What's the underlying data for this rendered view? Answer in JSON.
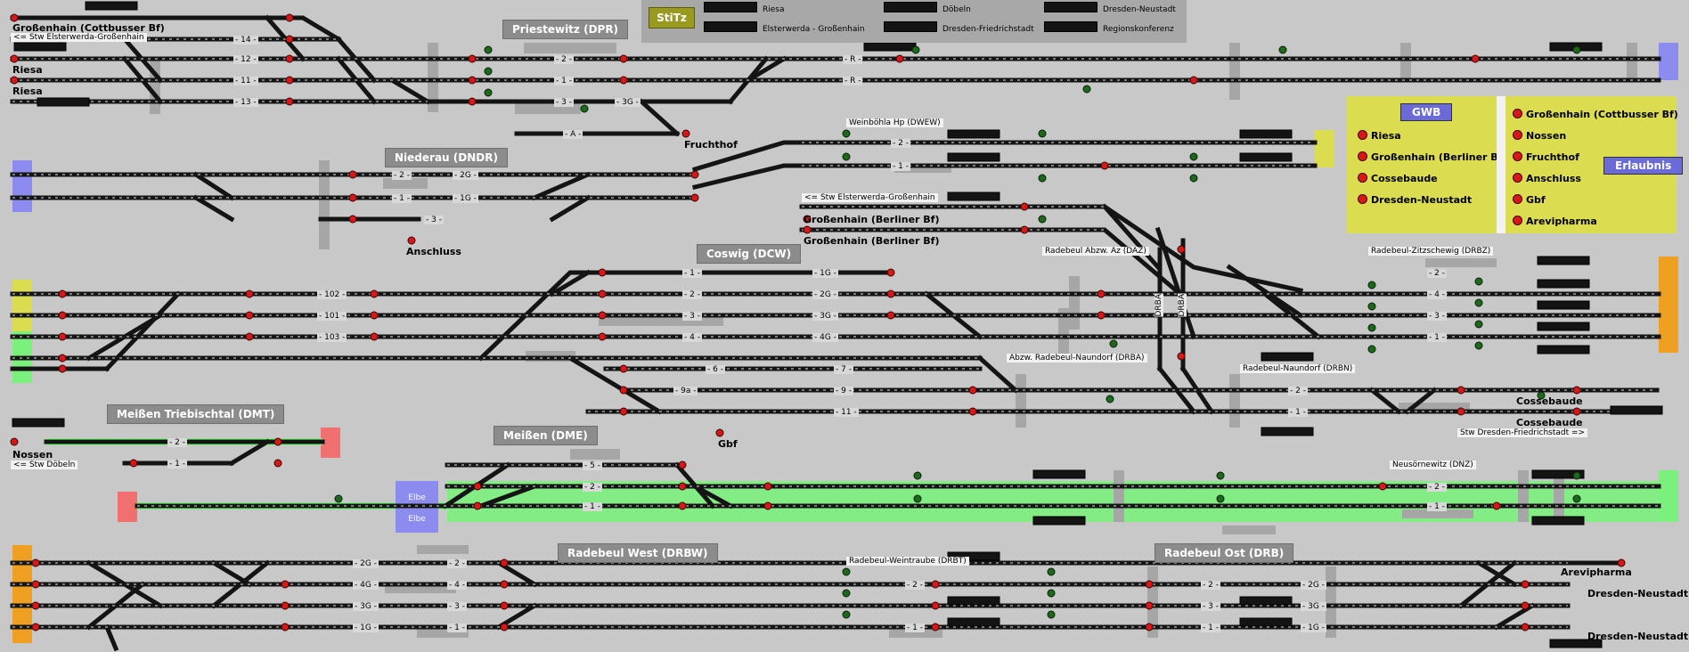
{
  "legend": {
    "stitz_label": "StiTz",
    "items": [
      "Riesa",
      "Elsterwerda - Großenhain",
      "Döbeln",
      "Dresden-Friedrichstadt",
      "Dresden-Neustadt",
      "Regionskonferenz"
    ]
  },
  "stations": [
    {
      "id": "dpr",
      "label": "Priestewitz (DPR)"
    },
    {
      "id": "dndr",
      "label": "Niederau (DNDR)"
    },
    {
      "id": "dcw",
      "label": "Coswig (DCW)"
    },
    {
      "id": "dmt",
      "label": "Meißen Triebischtal (DMT)"
    },
    {
      "id": "dme",
      "label": "Meißen (DME)"
    },
    {
      "id": "drbw",
      "label": "Radebeul West (DRBW)"
    },
    {
      "id": "drb",
      "label": "Radebeul Ost (DRB)"
    }
  ],
  "places": [
    {
      "id": "grossenhain-cott",
      "label": "Großenhain (Cottbusser Bf)"
    },
    {
      "id": "riesa1",
      "label": "Riesa"
    },
    {
      "id": "riesa2",
      "label": "Riesa"
    },
    {
      "id": "fruchthof",
      "label": "Fruchthof"
    },
    {
      "id": "anschluss",
      "label": "Anschluss"
    },
    {
      "id": "grossenhain-berl1",
      "label": "Großenhain (Berliner Bf)"
    },
    {
      "id": "grossenhain-berl2",
      "label": "Großenhain (Berliner Bf)"
    },
    {
      "id": "nossen",
      "label": "Nossen"
    },
    {
      "id": "gbf",
      "label": "Gbf"
    },
    {
      "id": "cossebaude1",
      "label": "Cossebaude"
    },
    {
      "id": "cossebaude2",
      "label": "Cossebaude"
    },
    {
      "id": "arevipharma",
      "label": "Arevipharma"
    },
    {
      "id": "dn1",
      "label": "Dresden-Neustadt"
    },
    {
      "id": "dn2",
      "label": "Dresden-Neustadt"
    }
  ],
  "notes": [
    {
      "id": "stw-elster1",
      "label": "<= Stw Elsterwerda-Großenhain"
    },
    {
      "id": "dwew",
      "label": "Weinböhla Hp (DWEW)"
    },
    {
      "id": "stw-elster2",
      "label": "<= Stw Elsterwerda-Großenhain"
    },
    {
      "id": "daz",
      "label": "Radebeul Abzw. Az (DAZ)"
    },
    {
      "id": "drbz",
      "label": "Radebeul-Zitzschewig (DRBZ)"
    },
    {
      "id": "drba",
      "label": "Abzw. Radebeul-Naundorf (DRBA)"
    },
    {
      "id": "drbn",
      "label": "Radebeul-Naundorf (DRBN)"
    },
    {
      "id": "stw-dresden",
      "label": "Stw Dresden-Friedrichstadt =>"
    },
    {
      "id": "stw-doebeln",
      "label": "<= Stw Döbeln"
    },
    {
      "id": "dnz",
      "label": "Neusörnewitz (DNZ)"
    },
    {
      "id": "drbt",
      "label": "Radebeul-Weintraube (DRBT)"
    }
  ],
  "elbe": [
    "Elbe",
    "Elbe"
  ],
  "drba_vertical": [
    "DRBA",
    "DRBA"
  ],
  "track_labels": {
    "priestewitz": [
      "14",
      "12",
      "11",
      "13"
    ],
    "dpr_main": [
      "2",
      "1",
      "3",
      "3G",
      "A"
    ],
    "right_top": [
      "R",
      "R"
    ],
    "dwew": [
      "2",
      "1"
    ],
    "niederau": [
      "2",
      "2G",
      "1",
      "1G",
      "3"
    ],
    "coswig_left": [
      "102",
      "101",
      "103"
    ],
    "coswig_main": [
      "1",
      "1G",
      "2",
      "2G",
      "3",
      "3G",
      "4",
      "4G"
    ],
    "coswig_lower": [
      "6",
      "7",
      "9a",
      "9",
      "11"
    ],
    "drbz": [
      "2",
      "4",
      "3",
      "1"
    ],
    "drbn": [
      "2",
      "1"
    ],
    "meissen_tt": [
      "2",
      "1"
    ],
    "meissen": [
      "5",
      "2",
      "1"
    ],
    "dnz": [
      "2",
      "1"
    ],
    "rbw_left": [
      "2G",
      "4G",
      "3G",
      "1G"
    ],
    "rbw_main": [
      "2",
      "4",
      "3",
      "1"
    ],
    "drbt": [
      "2",
      "1"
    ],
    "drb": [
      "2",
      "2G",
      "3",
      "3G",
      "1",
      "1G"
    ]
  },
  "gwb_panel": {
    "title": "GWB",
    "items": [
      "Riesa",
      "Großenhain (Berliner Bf)",
      "Cossebaude",
      "Dresden-Neustadt"
    ]
  },
  "erlaubnis_panel": {
    "title": "Erlaubnis",
    "items": [
      "Großenhain (Cottbusser Bf)",
      "Nossen",
      "Fruchthof",
      "Anschluss",
      "Gbf",
      "Arevipharma"
    ]
  },
  "colors": {
    "background": "#c8c8c8",
    "track": "#141414",
    "track_occupied": "#7cf07c",
    "signal_red": "#d81818",
    "signal_green": "#1a6a1a",
    "tab_yellow": "#dcdc50",
    "tab_blue": "#8c8cf0",
    "tab_green": "#7cf07c",
    "tab_orange": "#f0a020",
    "tab_red": "#f07070"
  }
}
